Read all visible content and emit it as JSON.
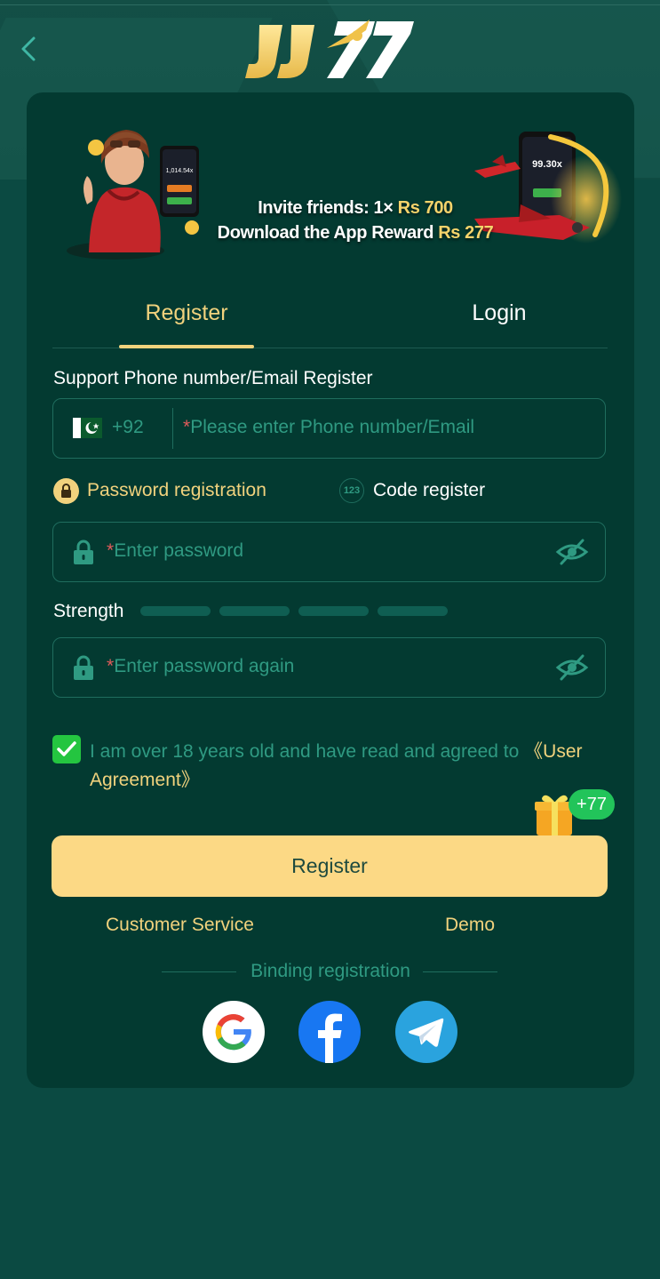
{
  "header": {
    "logo_text": "JJ77",
    "back_icon": "chevron-left-icon"
  },
  "banner": {
    "line1_prefix": "Invite friends: 1× ",
    "line1_amount": "Rs 700",
    "line2_prefix": "Download the App Reward ",
    "line2_amount": "Rs 277",
    "phone1_value": "1,014.54x",
    "phone2_value": "99.30x"
  },
  "tabs": {
    "register": "Register",
    "login": "Login"
  },
  "form": {
    "support_label": "Support Phone number/Email Register",
    "country_code": "+92",
    "required_mark": "*",
    "phone_placeholder": "Please enter Phone number/Email",
    "mode_password": "Password registration",
    "mode_code": "Code register",
    "mode_code_badge": "123",
    "password_placeholder": "Enter password",
    "strength_label": "Strength",
    "strength_level": 0,
    "password_again_placeholder": "Enter password again",
    "agree_text": "I am over 18 years old and have read and agreed to ",
    "agree_link": "《User Agreement》",
    "agree_checked": true,
    "bonus_badge": "+77",
    "register_button": "Register"
  },
  "links": {
    "customer_service": "Customer Service",
    "demo": "Demo"
  },
  "binding": {
    "title": "Binding registration",
    "providers": [
      "google-icon",
      "facebook-icon",
      "telegram-icon"
    ]
  },
  "colors": {
    "background": "#0b4a42",
    "card": "#033a31",
    "gold": "#f1d27d",
    "button": "#fcd985",
    "placeholder": "#2f9a82",
    "check": "#24c540"
  }
}
